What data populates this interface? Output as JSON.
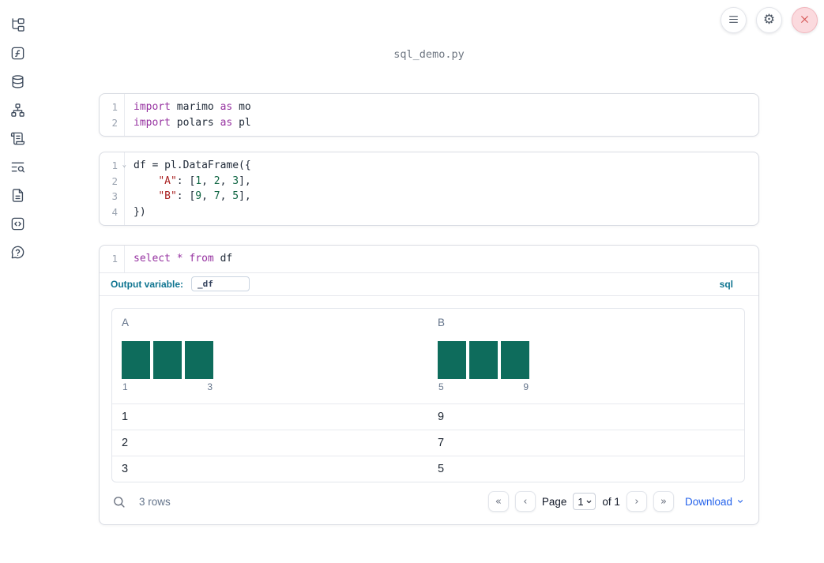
{
  "app": {
    "title": "sql_demo.py"
  },
  "colors": {
    "keyword": "#9632a0",
    "string": "#aa2222",
    "number": "#116644",
    "code_text": "#1f2937",
    "bar": "#0e6c5c",
    "accent": "#0e7490",
    "link": "#2563eb",
    "close_red": "#d4504f"
  },
  "sidebar": {
    "items": [
      {
        "icon": "file-tree-icon"
      },
      {
        "icon": "function-square-icon"
      },
      {
        "icon": "database-icon"
      },
      {
        "icon": "dependency-graph-icon"
      },
      {
        "icon": "scroll-icon"
      },
      {
        "icon": "text-search-icon"
      },
      {
        "icon": "file-text-icon"
      },
      {
        "icon": "code-box-icon"
      },
      {
        "icon": "help-bubble-icon"
      }
    ]
  },
  "toolbar": {
    "buttons": [
      {
        "icon": "menu-icon"
      },
      {
        "icon": "gear-icon"
      },
      {
        "icon": "close-icon"
      }
    ]
  },
  "cells": [
    {
      "name": "imports-cell",
      "lines": [
        {
          "n": "1",
          "tokens": [
            {
              "t": "kw",
              "v": "import"
            },
            {
              "t": "pl",
              "v": " marimo "
            },
            {
              "t": "kw",
              "v": "as"
            },
            {
              "t": "pl",
              "v": " mo"
            }
          ]
        },
        {
          "n": "2",
          "tokens": [
            {
              "t": "kw",
              "v": "import"
            },
            {
              "t": "pl",
              "v": " polars "
            },
            {
              "t": "kw",
              "v": "as"
            },
            {
              "t": "pl",
              "v": " pl"
            }
          ]
        }
      ]
    },
    {
      "name": "dataframe-cell",
      "lines": [
        {
          "n": "1",
          "fold": true,
          "tokens": [
            {
              "t": "pl",
              "v": "df = pl.DataFrame({"
            }
          ]
        },
        {
          "n": "2",
          "tokens": [
            {
              "t": "pl",
              "v": "    "
            },
            {
              "t": "str",
              "v": "\"A\""
            },
            {
              "t": "pl",
              "v": ": ["
            },
            {
              "t": "num",
              "v": "1"
            },
            {
              "t": "pl",
              "v": ", "
            },
            {
              "t": "num",
              "v": "2"
            },
            {
              "t": "pl",
              "v": ", "
            },
            {
              "t": "num",
              "v": "3"
            },
            {
              "t": "pl",
              "v": "],"
            }
          ]
        },
        {
          "n": "3",
          "tokens": [
            {
              "t": "pl",
              "v": "    "
            },
            {
              "t": "str",
              "v": "\"B\""
            },
            {
              "t": "pl",
              "v": ": ["
            },
            {
              "t": "num",
              "v": "9"
            },
            {
              "t": "pl",
              "v": ", "
            },
            {
              "t": "num",
              "v": "7"
            },
            {
              "t": "pl",
              "v": ", "
            },
            {
              "t": "num",
              "v": "5"
            },
            {
              "t": "pl",
              "v": "],"
            }
          ]
        },
        {
          "n": "4",
          "tokens": [
            {
              "t": "pl",
              "v": "})"
            }
          ]
        }
      ]
    },
    {
      "name": "sql-cell",
      "lines": [
        {
          "n": "1",
          "tokens": [
            {
              "t": "kw",
              "v": "select"
            },
            {
              "t": "pl",
              "v": " "
            },
            {
              "t": "kw",
              "v": "*"
            },
            {
              "t": "pl",
              "v": " "
            },
            {
              "t": "kw",
              "v": "from"
            },
            {
              "t": "pl",
              "v": " df"
            }
          ]
        }
      ],
      "footer": {
        "output_variable_label": "Output variable:",
        "output_variable_value": "_df",
        "language_badge": "sql"
      }
    }
  ],
  "table": {
    "columns": [
      {
        "header": "A",
        "hist": {
          "bars": [
            1,
            1,
            1
          ],
          "min_label": "1",
          "max_label": "3"
        }
      },
      {
        "header": "B",
        "hist": {
          "bars": [
            1,
            1,
            1
          ],
          "min_label": "5",
          "max_label": "9"
        }
      }
    ],
    "rows": [
      [
        "1",
        "9"
      ],
      [
        "2",
        "7"
      ],
      [
        "3",
        "5"
      ]
    ],
    "footer": {
      "row_count": "3 rows",
      "pagination": {
        "page_label": "Page",
        "page_value": "1",
        "of_label": "of 1",
        "buttons": [
          {
            "icon": "first-page-icon",
            "glyph": "«"
          },
          {
            "icon": "prev-page-icon",
            "glyph": "‹"
          },
          {
            "icon": "next-page-icon",
            "glyph": "›"
          },
          {
            "icon": "last-page-icon",
            "glyph": "»"
          }
        ]
      },
      "download_label": "Download"
    }
  }
}
